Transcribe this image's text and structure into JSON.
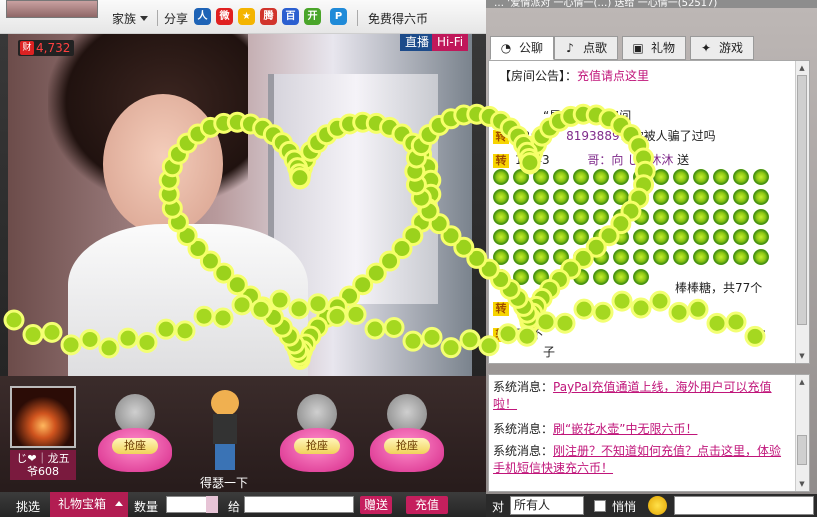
{
  "top_strip_text": "… ’爱情派对 一心情一(…) 送给 一心情一(52517)",
  "topbar": {
    "family_label": "家族",
    "share_label": "分享",
    "free_coins_label": "免费得六币",
    "share_icons": [
      "renren-icon",
      "weibo-icon",
      "qzone-icon",
      "tencent-icon",
      "baidu-icon",
      "kaixin-icon",
      "paipai-icon"
    ],
    "colors": {
      "renren": "#1e63b6",
      "weibo": "#e02020",
      "qzone": "#f4b400",
      "tencent": "#d1342c",
      "baidu": "#2b5fd0",
      "kaixin": "#4aa52a",
      "paipai": "#1f8ad8"
    }
  },
  "video": {
    "rich_badge_icon": "财",
    "rich_value": "4,732",
    "live_badge": "直播",
    "hifi_badge": "Hi-Fi"
  },
  "seats": {
    "fan_name_line1": "じ❤｜龙五",
    "fan_name_line2": "爷608",
    "grab_seat_label": "抢座",
    "character_label": "得瑟一下"
  },
  "gift_bar": {
    "pick_label": "挑选",
    "gift_box_label": "礼物宝箱",
    "qty_label": "数量",
    "to_label": "给",
    "send_label": "赠送",
    "recharge_label": "充值"
  },
  "tabs": [
    {
      "label": "公聊",
      "icon": "chat-bubble-icon",
      "glyph": "◔"
    },
    {
      "label": "点歌",
      "icon": "microphone-icon",
      "glyph": "♪"
    },
    {
      "label": "礼物",
      "icon": "gift-icon",
      "glyph": "▣"
    },
    {
      "label": "游戏",
      "icon": "gamepad-icon",
      "glyph": "✦"
    }
  ],
  "chat": {
    "notice_prefix": "【房间公告】：",
    "notice_link": "充值请点这里",
    "msg_enter": "“昆船” 进入房间",
    "msg_time1": "12:",
    "msg_user1": "8193889",
    "msg_text1": "：你被人骗了过吗",
    "msg_time2": "12:43",
    "msg_user2": "哥：向",
    "msg_target2": "じ❤沐沐",
    "msg_send_word": "送",
    "gift_summary": "棒棒糖，共77个",
    "msg_tail_user": "子",
    "zhuan_badge": "转",
    "partial_line": "了 不",
    "colon_tail": "："
  },
  "system": {
    "label": "系统消息：",
    "msg1": "PayPal充值通道上线，海外用户可以充值啦！",
    "msg2": "刷“嵌花水壶”中无限六币！",
    "msg3": "刚注册？不知道如何充值？点击这里，体验手机短信快速充六币！"
  },
  "bottom_chat": {
    "to_label": "对",
    "to_value": "所有人",
    "whisper_label": "悄悄"
  }
}
